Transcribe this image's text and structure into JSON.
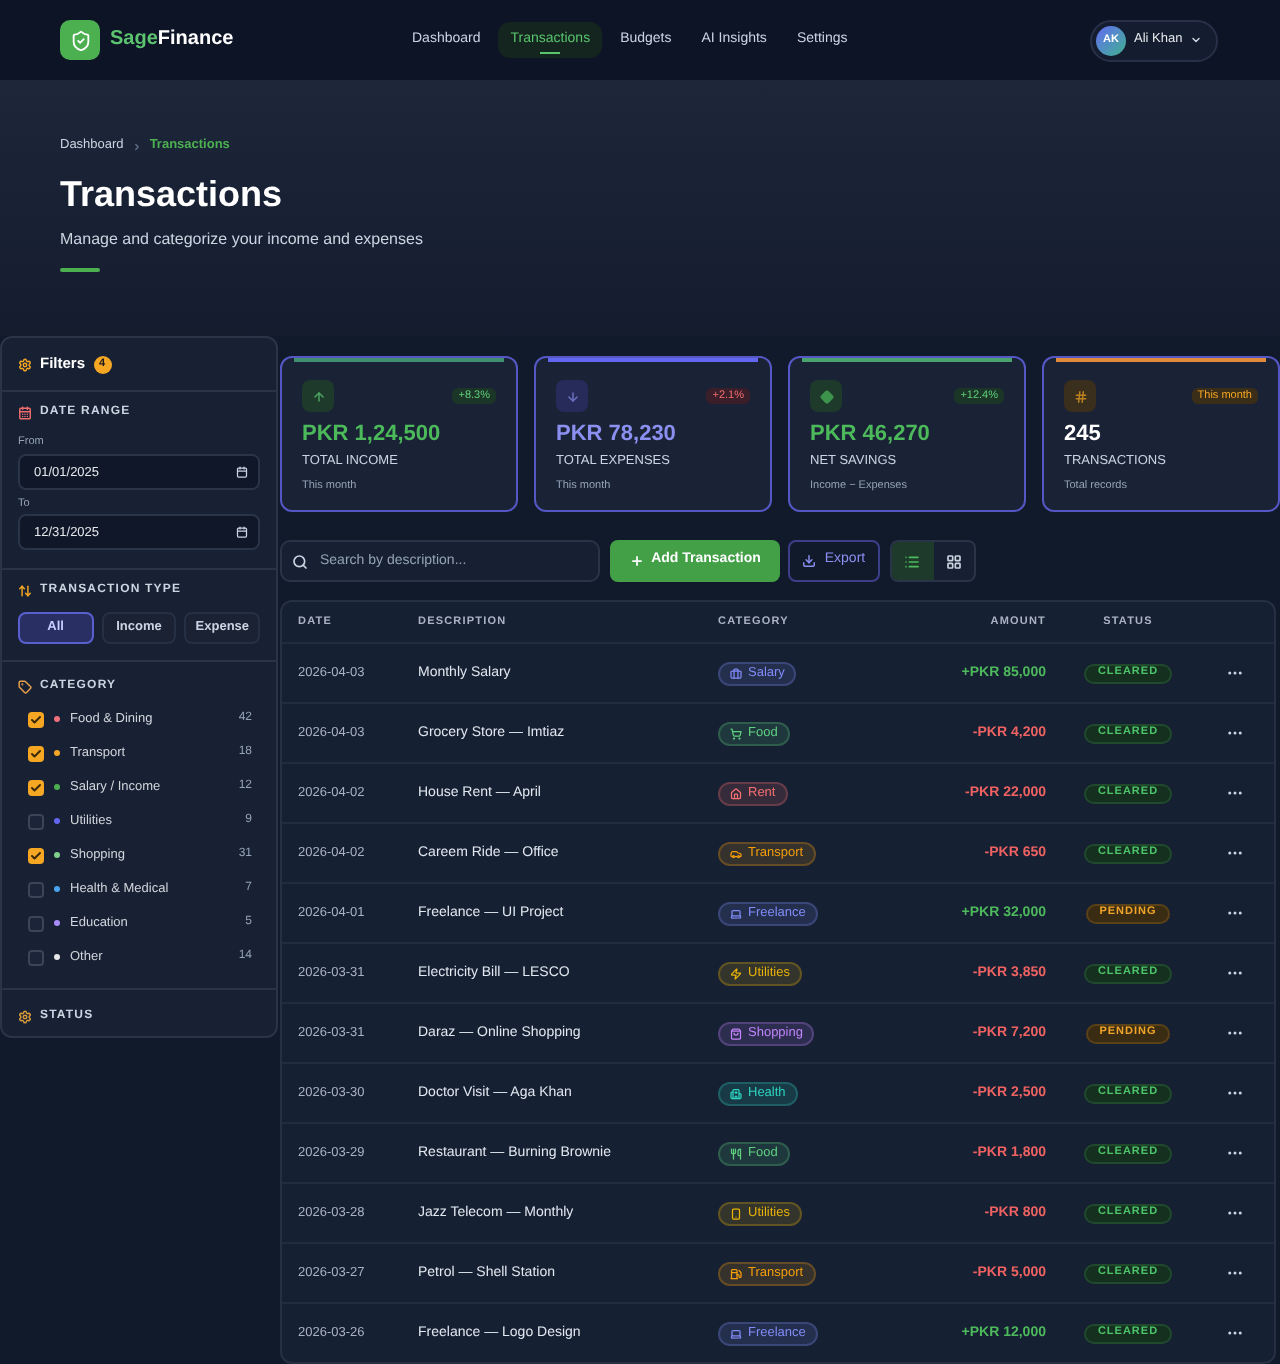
{
  "header": {
    "brand": {
      "accent": "Sage",
      "rest": "Finance"
    },
    "nav": [
      {
        "label": "Dashboard",
        "selected": false
      },
      {
        "label": "Transactions",
        "selected": true
      },
      {
        "label": "Budgets",
        "selected": false
      },
      {
        "label": "AI Insights",
        "selected": false
      },
      {
        "label": "Settings",
        "selected": false
      }
    ],
    "user": {
      "initials": "AK",
      "name": "Ali Khan"
    }
  },
  "hero": {
    "breadcrumb": {
      "links": [
        "Dashboard"
      ],
      "current": "Transactions"
    },
    "title": "Transactions",
    "subtitle": "Manage and categorize your income and expenses"
  },
  "filters": {
    "title": "Filters",
    "count": "4",
    "date_range": {
      "title": "DATE RANGE",
      "from": {
        "label": "From",
        "value": "01/01/2025"
      },
      "to": {
        "label": "To",
        "value": "12/31/2025"
      }
    },
    "transaction_type": {
      "title": "TRANSACTION TYPE",
      "options": [
        {
          "label": "All",
          "selected": true
        },
        {
          "label": "Income",
          "selected": false
        },
        {
          "label": "Expense",
          "selected": false
        }
      ]
    },
    "category": {
      "title": "CATEGORY",
      "items": [
        {
          "label": "Food & Dining",
          "color": "#f0707e",
          "count": "42",
          "checked": true
        },
        {
          "label": "Transport",
          "color": "#f5a623",
          "count": "18",
          "checked": true
        },
        {
          "label": "Salary / Income",
          "color": "#4caf50",
          "count": "12",
          "checked": true
        },
        {
          "label": "Utilities",
          "color": "#6366f1",
          "count": "9",
          "checked": false
        },
        {
          "label": "Shopping",
          "color": "#7fd18b",
          "count": "31",
          "checked": true
        },
        {
          "label": "Health & Medical",
          "color": "#4aa3f0",
          "count": "7",
          "checked": false
        },
        {
          "label": "Education",
          "color": "#a78bfa",
          "count": "5",
          "checked": false
        },
        {
          "label": "Other",
          "color": "#e5e7eb",
          "count": "14",
          "checked": false
        }
      ]
    },
    "status": {
      "title": "STATUS"
    }
  },
  "stats": [
    {
      "kind": "income",
      "value": "PKR 1,24,500",
      "label": "TOTAL INCOME",
      "note": "This month",
      "badge": "+8.3%"
    },
    {
      "kind": "expense",
      "value": "PKR 78,230",
      "label": "TOTAL EXPENSES",
      "note": "This month",
      "badge": "+2.1%"
    },
    {
      "kind": "savings",
      "value": "PKR 46,270",
      "label": "NET SAVINGS",
      "note": "Income − Expenses",
      "badge": "+12.4%"
    },
    {
      "kind": "count",
      "value": "245",
      "label": "TRANSACTIONS",
      "note": "Total records",
      "badge": "This month"
    }
  ],
  "toolbar": {
    "search": {
      "placeholder": "Search by description..."
    },
    "add_button": "Add Transaction",
    "export_button": "Export",
    "views": [
      {
        "kind": "list",
        "selected": true
      },
      {
        "kind": "grid",
        "selected": false
      }
    ]
  },
  "table": {
    "columns": [
      "DATE",
      "DESCRIPTION",
      "CATEGORY",
      "AMOUNT",
      "STATUS"
    ],
    "rows": [
      {
        "kind": "income",
        "date": "2026-04-03",
        "description": "Monthly Salary",
        "category": {
          "label": "Salary",
          "kind": "salary",
          "color": "#818cf8"
        },
        "amount": "+PKR 85,000",
        "status": {
          "label": "CLEARED",
          "kind": "cleared"
        }
      },
      {
        "kind": "expense",
        "date": "2026-04-03",
        "description": "Grocery Store — Imtiaz",
        "category": {
          "label": "Food",
          "kind": "groceries",
          "color": "#5fcf80"
        },
        "amount": "-PKR 4,200",
        "status": {
          "label": "CLEARED",
          "kind": "cleared"
        }
      },
      {
        "kind": "expense",
        "date": "2026-04-02",
        "description": "House Rent — April",
        "category": {
          "label": "Rent",
          "kind": "rent",
          "color": "#f87171"
        },
        "amount": "-PKR 22,000",
        "status": {
          "label": "CLEARED",
          "kind": "cleared"
        }
      },
      {
        "kind": "expense",
        "date": "2026-04-02",
        "description": "Careem Ride — Office",
        "category": {
          "label": "Transport",
          "kind": "ride",
          "color": "#f59e0b"
        },
        "amount": "-PKR 650",
        "status": {
          "label": "CLEARED",
          "kind": "cleared"
        }
      },
      {
        "kind": "income",
        "date": "2026-04-01",
        "description": "Freelance — UI Project",
        "category": {
          "label": "Freelance",
          "kind": "freelance",
          "color": "#818cf8"
        },
        "amount": "+PKR 32,000",
        "status": {
          "label": "PENDING",
          "kind": "pending"
        }
      },
      {
        "kind": "expense",
        "date": "2026-03-31",
        "description": "Electricity Bill — LESCO",
        "category": {
          "label": "Utilities",
          "kind": "electricity",
          "color": "#eab308"
        },
        "amount": "-PKR 3,850",
        "status": {
          "label": "CLEARED",
          "kind": "cleared"
        }
      },
      {
        "kind": "expense",
        "date": "2026-03-31",
        "description": "Daraz — Online Shopping",
        "category": {
          "label": "Shopping",
          "kind": "shopping",
          "color": "#c084fc"
        },
        "amount": "-PKR 7,200",
        "status": {
          "label": "PENDING",
          "kind": "pending"
        }
      },
      {
        "kind": "expense",
        "date": "2026-03-30",
        "description": "Doctor Visit — Aga Khan",
        "category": {
          "label": "Health",
          "kind": "health",
          "color": "#2dd4bf"
        },
        "amount": "-PKR 2,500",
        "status": {
          "label": "CLEARED",
          "kind": "cleared"
        }
      },
      {
        "kind": "expense",
        "date": "2026-03-29",
        "description": "Restaurant — Burning Brownie",
        "category": {
          "label": "Food",
          "kind": "restaurant",
          "color": "#5fcf80"
        },
        "amount": "-PKR 1,800",
        "status": {
          "label": "CLEARED",
          "kind": "cleared"
        }
      },
      {
        "kind": "expense",
        "date": "2026-03-28",
        "description": "Jazz Telecom — Monthly",
        "category": {
          "label": "Utilities",
          "kind": "telecom",
          "color": "#eab308"
        },
        "amount": "-PKR 800",
        "status": {
          "label": "CLEARED",
          "kind": "cleared"
        }
      },
      {
        "kind": "expense",
        "date": "2026-03-27",
        "description": "Petrol — Shell Station",
        "category": {
          "label": "Transport",
          "kind": "fuel",
          "color": "#f59e0b"
        },
        "amount": "-PKR 5,000",
        "status": {
          "label": "CLEARED",
          "kind": "cleared"
        }
      },
      {
        "kind": "income",
        "date": "2026-03-26",
        "description": "Freelance — Logo Design",
        "category": {
          "label": "Freelance",
          "kind": "freelance",
          "color": "#818cf8"
        },
        "amount": "+PKR 12,000",
        "status": {
          "label": "CLEARED",
          "kind": "cleared"
        }
      }
    ]
  }
}
